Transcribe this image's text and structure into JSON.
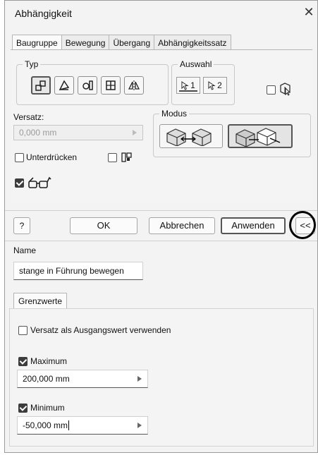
{
  "window": {
    "title": "Abhängigkeit",
    "close_glyph": "✕"
  },
  "tabs": [
    {
      "label": "Baugruppe",
      "active": true
    },
    {
      "label": "Bewegung",
      "active": false
    },
    {
      "label": "Übergang",
      "active": false
    },
    {
      "label": "Abhängigkeitssatz",
      "active": false
    }
  ],
  "typ": {
    "legend": "Typ",
    "buttons": [
      {
        "icon": "mate-constraint-icon",
        "selected": true
      },
      {
        "icon": "angle-constraint-icon",
        "selected": false
      },
      {
        "icon": "tangent-constraint-icon",
        "selected": false
      },
      {
        "icon": "insert-constraint-icon",
        "selected": false
      },
      {
        "icon": "symmetry-constraint-icon",
        "selected": false
      }
    ]
  },
  "auswahl": {
    "legend": "Auswahl",
    "select1_label": "1",
    "select2_label": "2",
    "pick_part_first_checked": false
  },
  "versatz": {
    "label": "Versatz:",
    "value": "0,000 mm",
    "disabled": true
  },
  "modus": {
    "legend": "Modus",
    "selected_index": 1
  },
  "unterdruecken": {
    "label": "Unterdrücken",
    "checked": false
  },
  "limits_toggle_checked": false,
  "show_preview_checked": true,
  "bottom_buttons": {
    "help": "?",
    "ok": "OK",
    "cancel": "Abbrechen",
    "apply": "Anwenden",
    "expand": "<<"
  },
  "name_section": {
    "label": "Name",
    "value": "stange in Führung bewegen"
  },
  "grenzwerte": {
    "tab_label": "Grenzwerte",
    "use_offset_label": "Versatz als Ausgangswert verwenden",
    "use_offset_checked": false,
    "maximum": {
      "label": "Maximum",
      "checked": true,
      "value": "200,000 mm"
    },
    "minimum": {
      "label": "Minimum",
      "checked": true,
      "value": "-50,000 mm"
    }
  }
}
